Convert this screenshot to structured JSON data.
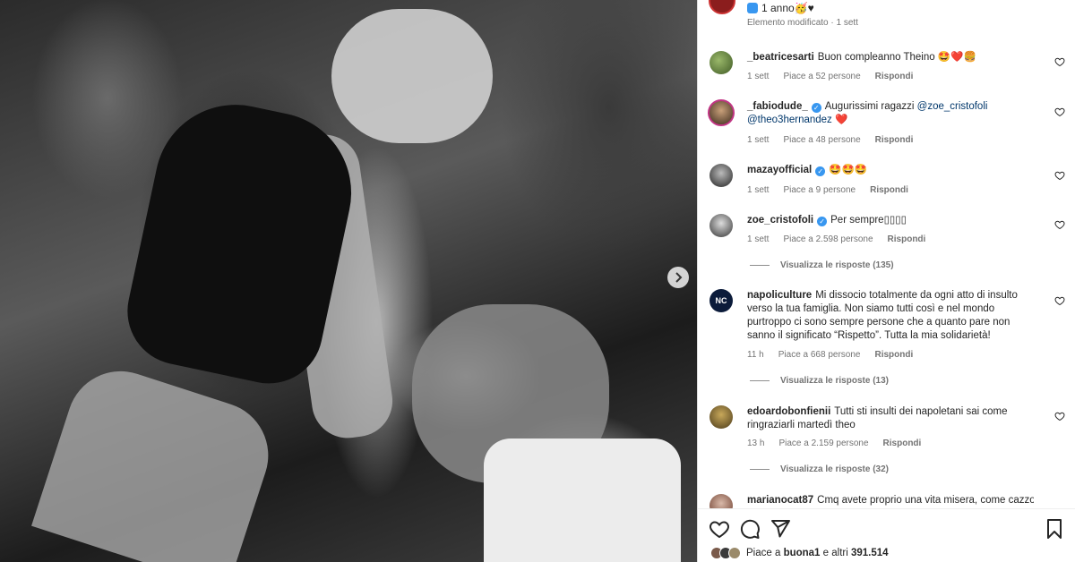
{
  "post": {
    "caption_text": "1 anno",
    "caption_emojis": "🥳♥",
    "edited_label": "Elemento modificato",
    "edited_time": "1 sett"
  },
  "comments": [
    {
      "username": "_beatricesarti",
      "verified": false,
      "text": "Buon compleanno Theino",
      "emojis": "🤩❤️🍔",
      "time": "1 sett",
      "likes": "Piace a 52 persone",
      "reply": "Rispondi"
    },
    {
      "username": "_fabiodude_",
      "verified": true,
      "text": "Augurissimi ragazzi",
      "mention1": "@zoe_cristofoli",
      "mention2": "@theo3hernandez",
      "emojis": "❤️",
      "time": "1 sett",
      "likes": "Piace a 48 persone",
      "reply": "Rispondi"
    },
    {
      "username": "mazayofficial",
      "verified": true,
      "text": "",
      "emojis": "🤩🤩🤩",
      "time": "1 sett",
      "likes": "Piace a 9 persone",
      "reply": "Rispondi"
    },
    {
      "username": "zoe_cristofoli",
      "verified": true,
      "text": "Per sempre",
      "emojis": "▯▯▯▯",
      "time": "1 sett",
      "likes": "Piace a 2.598 persone",
      "reply": "Rispondi",
      "view_replies": "Visualizza le risposte (135)"
    },
    {
      "username": "napoliculture",
      "verified": false,
      "text": "Mi dissocio totalmente da ogni atto di insulto verso la tua famiglia. Non siamo tutti così e nel mondo purtroppo ci sono sempre persone che a quanto pare non sanno il significato “Rispetto”. Tutta la mia solidarietà!",
      "time": "11 h",
      "likes": "Piace a 668 persone",
      "reply": "Rispondi",
      "view_replies": "Visualizza le risposte (13)",
      "avatar_text": "NC"
    },
    {
      "username": "edoardobonfienii",
      "verified": false,
      "text": "Tutti sti insulti dei napoletani sai come ringraziarli martedì theo",
      "time": "13 h",
      "likes": "Piace a 2.159 persone",
      "reply": "Rispondi",
      "view_replies": "Visualizza le risposte (32)"
    },
    {
      "username": "marianocat87",
      "verified": false,
      "text": "Cmq avete proprio una vita misera, come cazzo"
    }
  ],
  "footer": {
    "likes_prefix": "Piace a",
    "likes_user": "buona1",
    "likes_suffix": "e altri",
    "likes_count": "391.514"
  },
  "colors": {
    "verified": "#3897f0",
    "mention": "#00376b",
    "meta": "#737373"
  }
}
